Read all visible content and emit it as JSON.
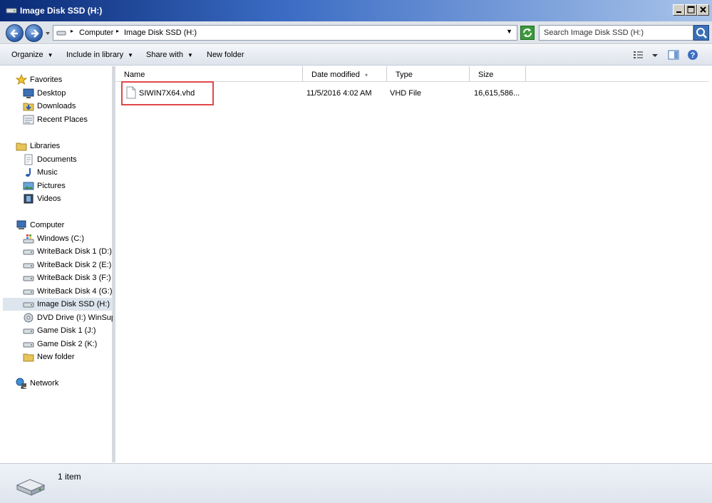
{
  "window": {
    "title": "Image Disk SSD (H:)"
  },
  "address": {
    "crumbs": [
      "Computer",
      "Image Disk SSD (H:)"
    ]
  },
  "search": {
    "placeholder": "Search Image Disk SSD (H:)"
  },
  "toolbar": {
    "organize": "Organize",
    "include_in_library": "Include in library",
    "share_with": "Share with",
    "new_folder": "New folder"
  },
  "nav": {
    "favorites": "Favorites",
    "desktop": "Desktop",
    "downloads": "Downloads",
    "recent_places": "Recent Places",
    "libraries": "Libraries",
    "documents": "Documents",
    "music": "Music",
    "pictures": "Pictures",
    "videos": "Videos",
    "computer": "Computer",
    "drives": [
      "Windows (C:)",
      "WriteBack Disk 1 (D:)",
      "WriteBack Disk 2 (E:)",
      "WriteBack Disk 3 (F:)",
      "WriteBack Disk 4 (G:)",
      "Image Disk SSD (H:)",
      "DVD Drive (I:) WinSup",
      "Game Disk 1 (J:)",
      "Game Disk 2 (K:)",
      "New folder"
    ],
    "network": "Network"
  },
  "columns": {
    "name": "Name",
    "date_modified": "Date modified",
    "type": "Type",
    "size": "Size"
  },
  "files": [
    {
      "name": "SIWIN7X64.vhd",
      "date_modified": "11/5/2016 4:02 AM",
      "type": "VHD File",
      "size": "16,615,586..."
    }
  ],
  "status": {
    "count": "1 item"
  },
  "colors": {
    "highlight": "#e04848",
    "selected_nav": "#dde5ee"
  }
}
